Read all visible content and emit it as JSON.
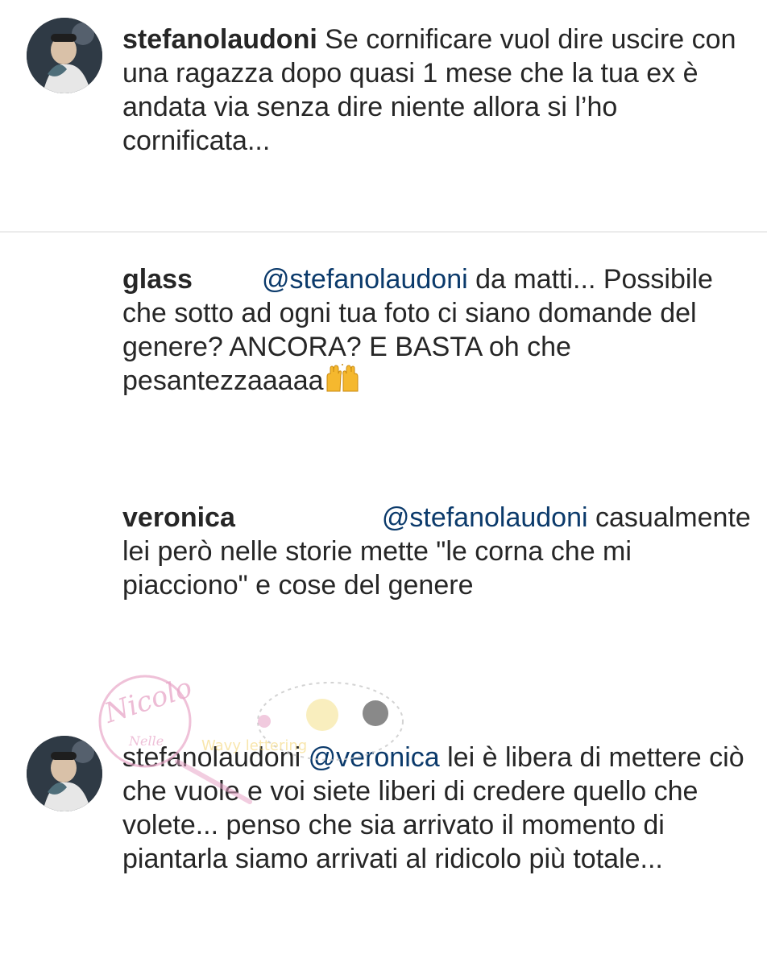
{
  "comments": [
    {
      "username": "stefanolaudoni",
      "text": "Se cornificare vuol dire uscire con una ragazza dopo quasi 1 mese che la tua ex è andata via senza dire niente allora si l’ho cornificata..."
    },
    {
      "username": "glass",
      "mention": "@stefanolaudoni",
      "text": "da matti... Possibile che sotto ad ogni tua foto ci siano domande del genere? ANCORA? E BASTA oh che pesantezzaaaaa",
      "emoji": "raising-hands-emoji"
    },
    {
      "username": "veronica",
      "mention": "@stefanolaudoni",
      "text": "casualmente lei però nelle storie mette \"le corna che mi piacciono\" e cose del genere"
    },
    {
      "username": "stefanolaudoni",
      "mention": "@veronica",
      "text": "lei è libera di mettere ciò che vuole e voi siete liberi di credere quello che volete... penso che sia arrivato il momento di piantarla siamo arrivati al ridicolo più totale..."
    }
  ],
  "watermark": {
    "text": "Nicolo",
    "subtext": "Nelle"
  },
  "colors": {
    "text": "#262626",
    "mention": "#0b3a6b",
    "divider": "#ececec",
    "watermark_pink": "#e8a6c8"
  }
}
